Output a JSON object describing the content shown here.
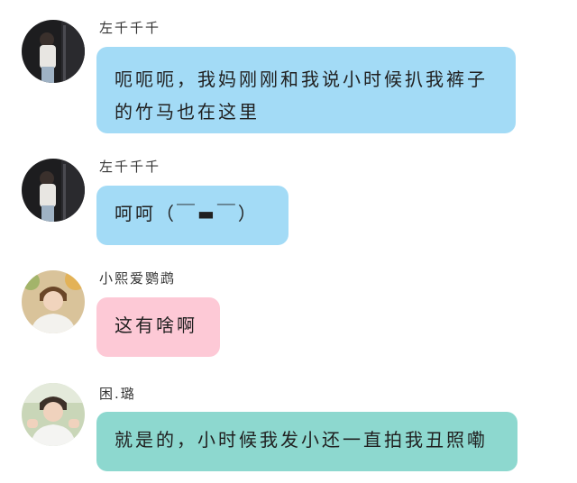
{
  "messages": [
    {
      "sender": "左千千千",
      "text": "呃呃呃，我妈刚刚和我说小时候扒我裤子的竹马也在这里",
      "bubble_color": "#a3dbf6"
    },
    {
      "sender": "左千千千",
      "text": "呵呵（￣▬￣）",
      "bubble_color": "#a3dbf6"
    },
    {
      "sender": "小熙爱鹦鹉",
      "text": "这有啥啊",
      "bubble_color": "#fdc9d6"
    },
    {
      "sender": "困.璐",
      "text": "就是的，小时候我发小还一直拍我丑照嘞",
      "bubble_color": "#8dd8cf"
    }
  ]
}
